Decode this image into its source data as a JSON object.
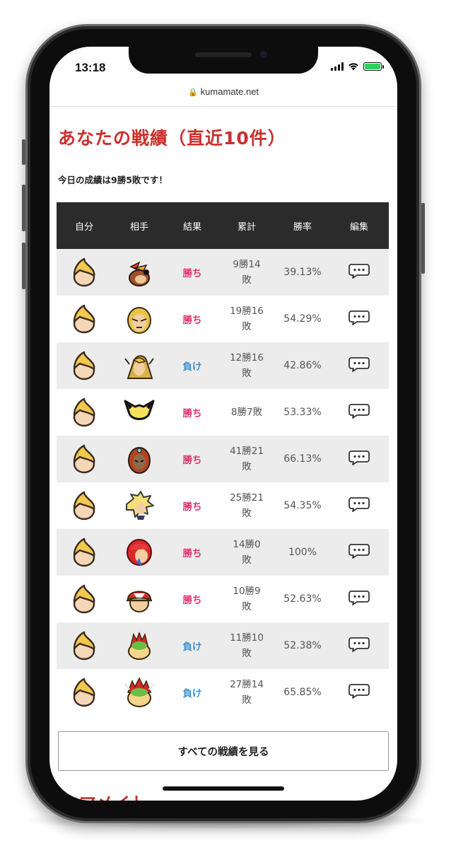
{
  "status_bar": {
    "time": "13:18"
  },
  "browser": {
    "url": "kumamate.net"
  },
  "page": {
    "title": "あなたの戦績（直近10件）",
    "summary": "今日の成績は9勝5敗です！",
    "next_heading": "クマメイト"
  },
  "table": {
    "headers": [
      "自分",
      "相手",
      "結果",
      "累計",
      "勝率",
      "編集"
    ],
    "rows": [
      {
        "self_icon": "lucas-icon",
        "opponent_icon": "banjo-kazooie-icon",
        "result": "勝ち",
        "result_type": "win",
        "record_top": "9勝14",
        "record_bottom": "敗",
        "rate": "39.13%"
      },
      {
        "self_icon": "lucas-icon",
        "opponent_icon": "ken-icon",
        "result": "勝ち",
        "result_type": "win",
        "record_top": "19勝16",
        "record_bottom": "敗",
        "rate": "54.29%"
      },
      {
        "self_icon": "lucas-icon",
        "opponent_icon": "link-icon",
        "result": "負け",
        "result_type": "lose",
        "record_top": "12勝16",
        "record_bottom": "敗",
        "rate": "42.86%"
      },
      {
        "self_icon": "lucas-icon",
        "opponent_icon": "pichu-icon",
        "result": "勝ち",
        "result_type": "win",
        "record_top": "8勝7敗",
        "record_bottom": "",
        "rate": "53.33%"
      },
      {
        "self_icon": "lucas-icon",
        "opponent_icon": "ganondorf-icon",
        "result": "勝ち",
        "result_type": "win",
        "record_top": "41勝21",
        "record_bottom": "敗",
        "rate": "66.13%"
      },
      {
        "self_icon": "lucas-icon",
        "opponent_icon": "cloud-icon",
        "result": "勝ち",
        "result_type": "win",
        "record_top": "25勝21",
        "record_bottom": "敗",
        "rate": "54.35%"
      },
      {
        "self_icon": "lucas-icon",
        "opponent_icon": "roy-icon",
        "result": "勝ち",
        "result_type": "win",
        "record_top": "14勝0",
        "record_bottom": "敗",
        "rate": "100%"
      },
      {
        "self_icon": "lucas-icon",
        "opponent_icon": "pokemon-trainer-icon",
        "result": "勝ち",
        "result_type": "win",
        "record_top": "10勝9",
        "record_bottom": "敗",
        "rate": "52.63%"
      },
      {
        "self_icon": "lucas-icon",
        "opponent_icon": "bowser-jr-icon",
        "result": "負け",
        "result_type": "lose",
        "record_top": "11勝10",
        "record_bottom": "敗",
        "rate": "52.38%"
      },
      {
        "self_icon": "lucas-icon",
        "opponent_icon": "bowser-icon",
        "result": "負け",
        "result_type": "lose",
        "record_top": "27勝14",
        "record_bottom": "敗",
        "rate": "65.85%"
      }
    ]
  },
  "buttons": {
    "view_all": "すべての戦績を見る"
  },
  "colors": {
    "title_red": "#c9302c",
    "win_pink": "#e2336f",
    "lose_blue": "#3b8fcf",
    "header_dark": "#2b2b2b"
  }
}
